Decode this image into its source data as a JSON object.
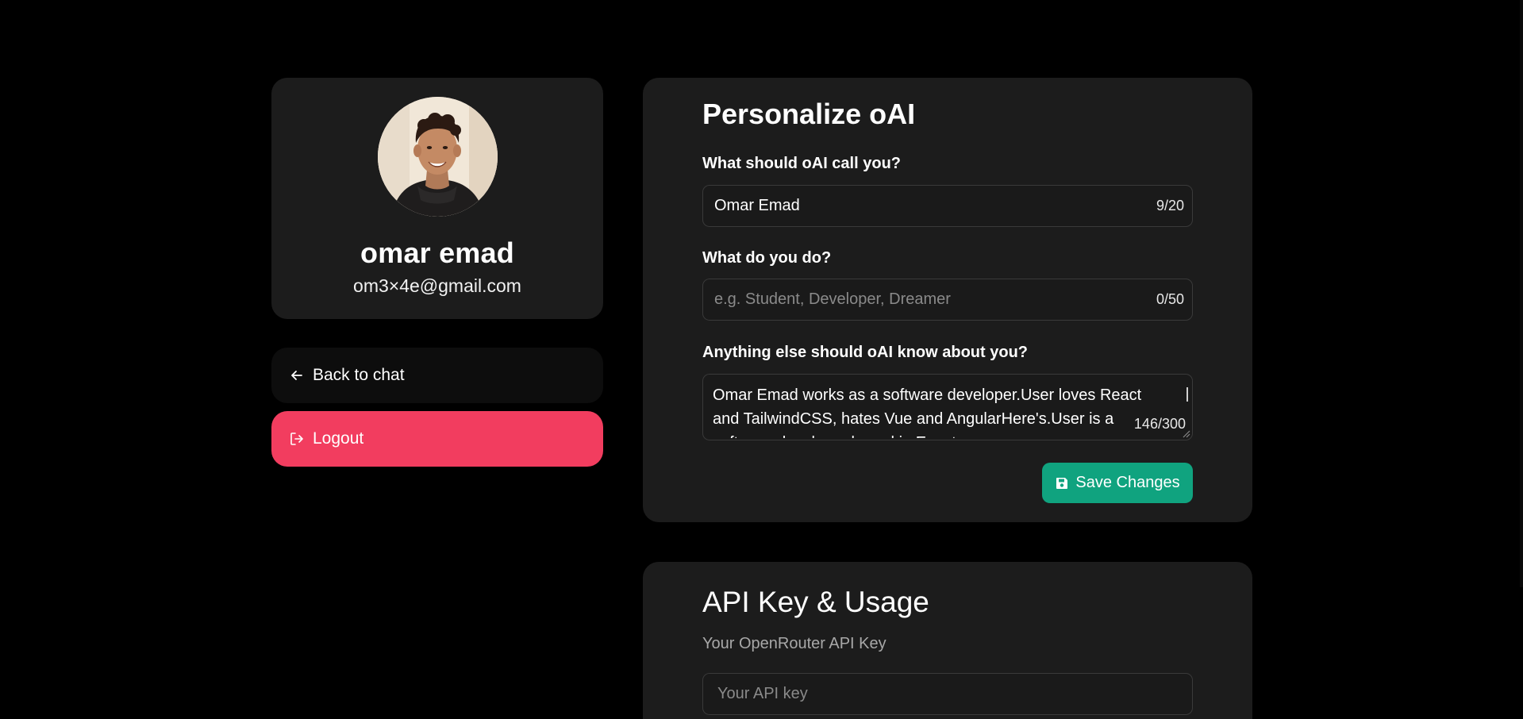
{
  "profile": {
    "name": "omar emad",
    "email": "om3×4e@gmail.com",
    "avatar_icon": "user-avatar-photo"
  },
  "nav": {
    "back_label": "Back to chat",
    "back_icon": "arrow-left-icon",
    "logout_label": "Logout",
    "logout_icon": "logout-icon"
  },
  "personalize": {
    "title": "Personalize oAI",
    "name_field": {
      "label": "What should oAI call you?",
      "value": "Omar Emad",
      "placeholder": "",
      "counter": "9/20"
    },
    "job_field": {
      "label": "What do you do?",
      "value": "",
      "placeholder": "e.g. Student, Developer, Dreamer",
      "counter": "0/50"
    },
    "about_field": {
      "label": "Anything else should oAI know about you?",
      "value": "Omar Emad works as a software developer.User loves React and TailwindCSS, hates Vue and AngularHere's.User is a software developer based in Egypt.",
      "counter": "146/300"
    },
    "save_label": "Save Changes",
    "save_icon": "floppy-disk-icon"
  },
  "api": {
    "title": "API Key & Usage",
    "subtitle": "Your OpenRouter API Key",
    "placeholder": "Your API key"
  },
  "colors": {
    "background": "#000000",
    "card": "#1c1c1c",
    "logout": "#f23d5f",
    "save": "#10a37f"
  }
}
